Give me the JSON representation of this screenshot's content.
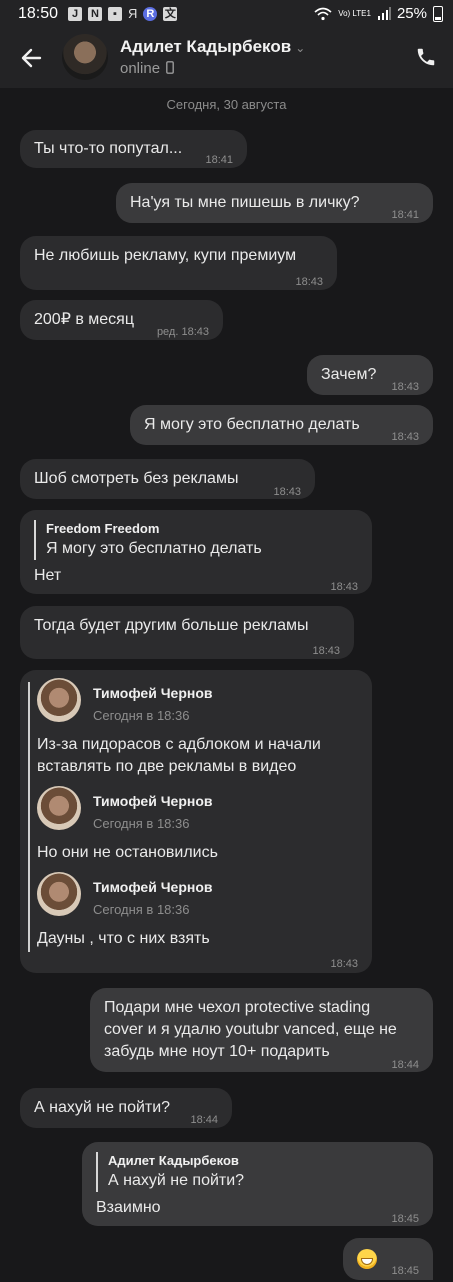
{
  "status_bar": {
    "time": "18:50",
    "icons": [
      "J",
      "N",
      "img",
      "Я",
      "R",
      "translate"
    ],
    "network": "Vo) LTE1",
    "battery": "25%"
  },
  "header": {
    "name": "Адилет Кадырбеков",
    "status": "online"
  },
  "date_separator": "Сегодня, 30 августа",
  "messages": [
    {
      "text": "Ты что-то попутал...",
      "time": "18:41"
    },
    {
      "text": "На'уя ты мне пишешь в личку?",
      "time": "18:41"
    },
    {
      "text": "Не любишь рекламу, купи премиум",
      "time": "18:43"
    },
    {
      "text": "200₽ в месяц",
      "time": "ред. 18:43"
    },
    {
      "text": "Зачем?",
      "time": "18:43"
    },
    {
      "text": "Я могу это бесплатно делать",
      "time": "18:43"
    },
    {
      "text": "Шоб смотреть без рекламы",
      "time": "18:43"
    },
    {
      "quote_name": "Freedom Freedom",
      "quote_text": "Я могу это бесплатно делать",
      "text": "Нет",
      "time": "18:43"
    },
    {
      "text": "Тогда будет другим больше рекламы",
      "time": "18:43"
    },
    {
      "forwarded": [
        {
          "name": "Тимофей Чернов",
          "date": "Сегодня в 18:36",
          "text_line1": "Из-за пидорасов  с адблоком и начали",
          "text_line2": "вставлять по две рекламы в видео"
        },
        {
          "name": "Тимофей Чернов",
          "date": "Сегодня в 18:36",
          "text_line1": "Но они не остановились"
        },
        {
          "name": "Тимофей Чернов",
          "date": "Сегодня в 18:36",
          "text_line1": "Дауны , что с них взять"
        }
      ],
      "time": "18:43"
    },
    {
      "text_line1": "Подари мне чехол protective stading",
      "text_line2": "cover и я удалю youtubr vanced, еще не",
      "text_line3": "забудь мне ноут 10+ подарить",
      "time": "18:44"
    },
    {
      "text": "А нахуй не пойти?",
      "time": "18:44"
    },
    {
      "quote_name": "Адилет Кадырбеков",
      "quote_text": "А нахуй не пойти?",
      "text": "Взаимно",
      "time": "18:45"
    },
    {
      "emoji": "grinning-face",
      "time": "18:45"
    }
  ]
}
